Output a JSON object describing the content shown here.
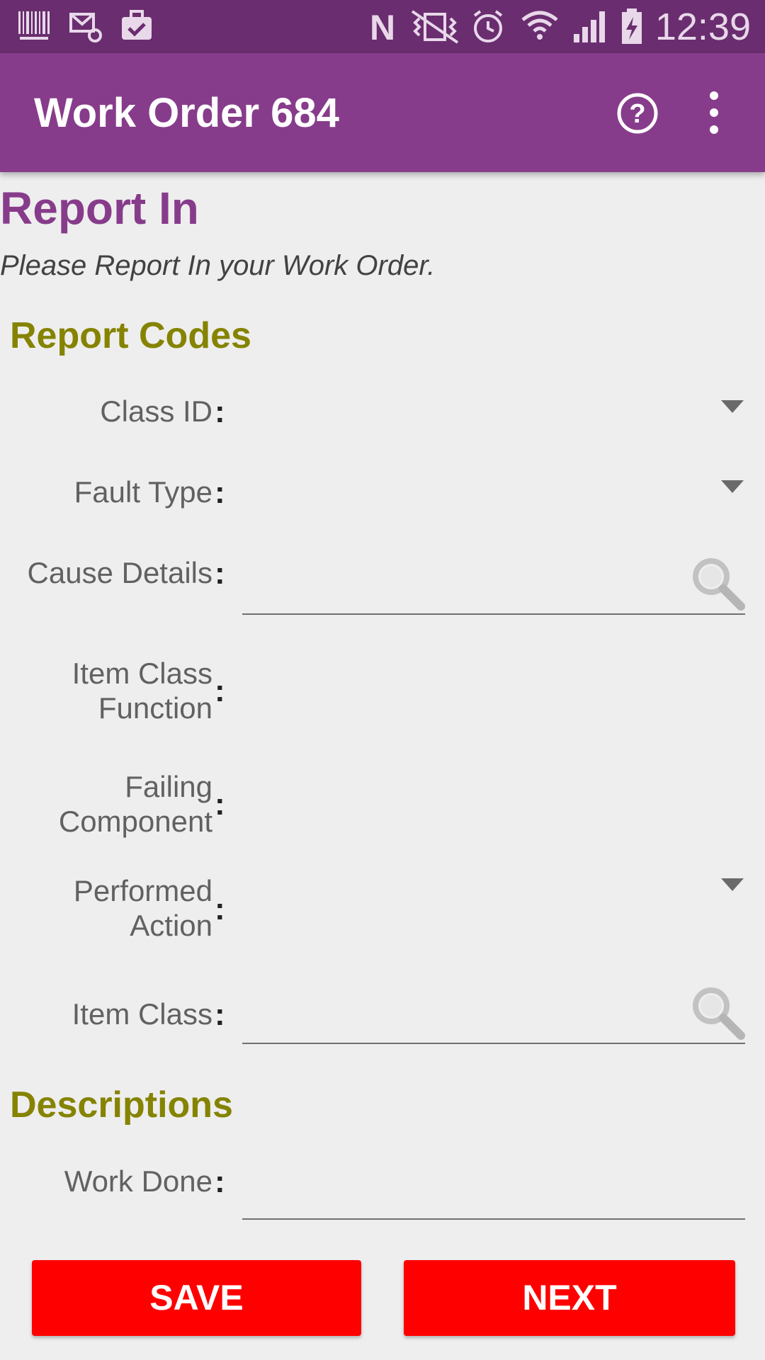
{
  "status_bar": {
    "time": "12:39",
    "icons": [
      "barcode-icon",
      "mail-settings-icon",
      "briefcase-check-icon",
      "nfc-icon",
      "vibrate-icon",
      "alarm-icon",
      "wifi-icon",
      "signal-icon",
      "battery-charging-icon"
    ]
  },
  "app_bar": {
    "title": "Work Order 684",
    "actions": [
      "help-icon",
      "more-options-icon"
    ],
    "color": "#873c8b"
  },
  "page": {
    "title": "Report In",
    "subtitle": "Please Report In your Work Order."
  },
  "report_codes": {
    "heading": "Report Codes",
    "fields": {
      "class_id": {
        "label": "Class ID",
        "colon": ":"
      },
      "fault_type": {
        "label": "Fault Type",
        "colon": ":"
      },
      "cause_details": {
        "label": "Cause Details",
        "colon": ":"
      },
      "item_class_function": {
        "label_line1": "Item Class",
        "label_line2": "Function",
        "colon": ":"
      },
      "failing_component": {
        "label_line1": "Failing",
        "label_line2": "Component",
        "colon": ":"
      },
      "performed_action": {
        "label_line1": "Performed",
        "label_line2": "Action",
        "colon": ":"
      },
      "item_class": {
        "label": "Item Class",
        "colon": ":"
      }
    }
  },
  "descriptions": {
    "heading": "Descriptions",
    "fields": {
      "work_done": {
        "label": "Work Done",
        "colon": ":"
      }
    }
  },
  "buttons": {
    "save_label": "SAVE",
    "next_label": "NEXT",
    "color": "#ff0000"
  }
}
